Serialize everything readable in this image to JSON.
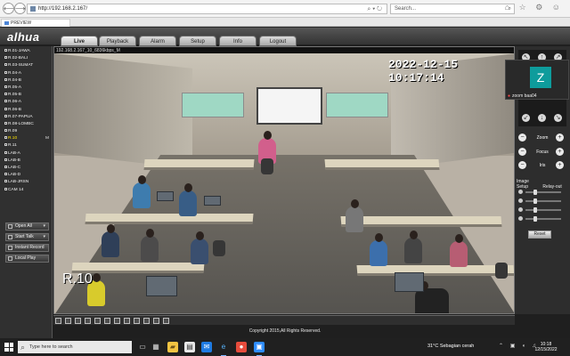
{
  "browser": {
    "back": "⟵",
    "forward": "⟶",
    "url": "http://192.168.2.167/",
    "address_tools": "⌕ ▾ ↻",
    "search_placeholder": "Search...",
    "search_icon": "⌕",
    "right_icons": "⌂ ☆ ⚙ ☺",
    "tab": "PREVIEW"
  },
  "app": {
    "logo": "alhua",
    "nav": [
      "Live",
      "Playback",
      "Alarm",
      "Setup",
      "Info",
      "Logout"
    ],
    "cameras": [
      "R.01-JAWA",
      "R.02-BALI",
      "R.03-SUMAT",
      "R.04-A",
      "R.04-B",
      "R.05-A",
      "R.05-B",
      "R.06-A",
      "R.06-B",
      "R.07-PAPUA",
      "R.08-LOMBC",
      "R.09",
      "R.10",
      "R.11",
      "LAB-A",
      "LAB-B",
      "LAB-C",
      "LAB-D",
      "LAB-JRSN",
      "CAM 14"
    ],
    "active_camera": "R.10",
    "active_marker": "M",
    "side_buttons": [
      "Open All",
      "Start Talk",
      "Instant Record",
      "Local Play"
    ],
    "stream_info": "192.168.2.167_10_6836kbps_M",
    "timestamp": "2022-12-15  10:17:14",
    "room_label": "R.10",
    "copyright": "Copyright 2015,All Rights Reserved."
  },
  "zoom": {
    "initial": "Z",
    "name": "zoom baa04",
    "mic_icon": "mic-muted-icon"
  },
  "controls": {
    "zoom": "Zoom",
    "focus": "Focus",
    "iris": "Iris",
    "image_setup": "Image Setup",
    "relay_out": "Relay-out",
    "reset": "Reset"
  },
  "taskbar": {
    "search": "Type here to search",
    "weather": "31°C  Sebagian cerah",
    "time": "10:18",
    "date": "12/15/2022"
  },
  "colors": {
    "accent": "#0e9c9c",
    "selected_camera": "#ffe400",
    "board": "#9fd8c4"
  }
}
